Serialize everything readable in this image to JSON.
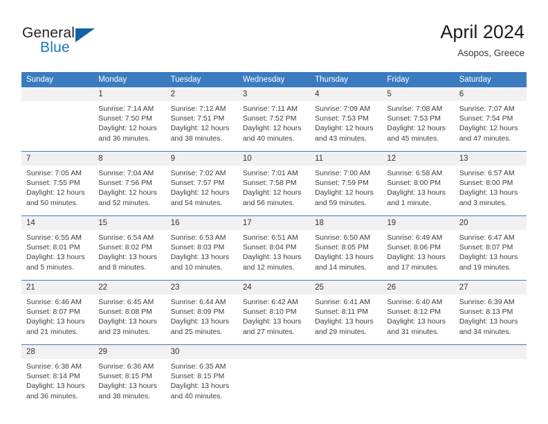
{
  "branding": {
    "logo_primary": "General",
    "logo_secondary": "Blue",
    "accent_color": "#1b76bf",
    "mark_color": "#1461a8"
  },
  "header": {
    "title": "April 2024",
    "location": "Asopos, Greece"
  },
  "calendar": {
    "header_bg": "#3b7cc0",
    "daynum_bg": "#f1f1f1",
    "weekday_headers": [
      "Sunday",
      "Monday",
      "Tuesday",
      "Wednesday",
      "Thursday",
      "Friday",
      "Saturday"
    ],
    "weeks": [
      [
        {
          "day": "",
          "sunrise": "",
          "sunset": "",
          "daylight_1": "",
          "daylight_2": ""
        },
        {
          "day": "1",
          "sunrise": "Sunrise: 7:14 AM",
          "sunset": "Sunset: 7:50 PM",
          "daylight_1": "Daylight: 12 hours",
          "daylight_2": "and 36 minutes."
        },
        {
          "day": "2",
          "sunrise": "Sunrise: 7:12 AM",
          "sunset": "Sunset: 7:51 PM",
          "daylight_1": "Daylight: 12 hours",
          "daylight_2": "and 38 minutes."
        },
        {
          "day": "3",
          "sunrise": "Sunrise: 7:11 AM",
          "sunset": "Sunset: 7:52 PM",
          "daylight_1": "Daylight: 12 hours",
          "daylight_2": "and 40 minutes."
        },
        {
          "day": "4",
          "sunrise": "Sunrise: 7:09 AM",
          "sunset": "Sunset: 7:53 PM",
          "daylight_1": "Daylight: 12 hours",
          "daylight_2": "and 43 minutes."
        },
        {
          "day": "5",
          "sunrise": "Sunrise: 7:08 AM",
          "sunset": "Sunset: 7:53 PM",
          "daylight_1": "Daylight: 12 hours",
          "daylight_2": "and 45 minutes."
        },
        {
          "day": "6",
          "sunrise": "Sunrise: 7:07 AM",
          "sunset": "Sunset: 7:54 PM",
          "daylight_1": "Daylight: 12 hours",
          "daylight_2": "and 47 minutes."
        }
      ],
      [
        {
          "day": "7",
          "sunrise": "Sunrise: 7:05 AM",
          "sunset": "Sunset: 7:55 PM",
          "daylight_1": "Daylight: 12 hours",
          "daylight_2": "and 50 minutes."
        },
        {
          "day": "8",
          "sunrise": "Sunrise: 7:04 AM",
          "sunset": "Sunset: 7:56 PM",
          "daylight_1": "Daylight: 12 hours",
          "daylight_2": "and 52 minutes."
        },
        {
          "day": "9",
          "sunrise": "Sunrise: 7:02 AM",
          "sunset": "Sunset: 7:57 PM",
          "daylight_1": "Daylight: 12 hours",
          "daylight_2": "and 54 minutes."
        },
        {
          "day": "10",
          "sunrise": "Sunrise: 7:01 AM",
          "sunset": "Sunset: 7:58 PM",
          "daylight_1": "Daylight: 12 hours",
          "daylight_2": "and 56 minutes."
        },
        {
          "day": "11",
          "sunrise": "Sunrise: 7:00 AM",
          "sunset": "Sunset: 7:59 PM",
          "daylight_1": "Daylight: 12 hours",
          "daylight_2": "and 59 minutes."
        },
        {
          "day": "12",
          "sunrise": "Sunrise: 6:58 AM",
          "sunset": "Sunset: 8:00 PM",
          "daylight_1": "Daylight: 13 hours",
          "daylight_2": "and 1 minute."
        },
        {
          "day": "13",
          "sunrise": "Sunrise: 6:57 AM",
          "sunset": "Sunset: 8:00 PM",
          "daylight_1": "Daylight: 13 hours",
          "daylight_2": "and 3 minutes."
        }
      ],
      [
        {
          "day": "14",
          "sunrise": "Sunrise: 6:55 AM",
          "sunset": "Sunset: 8:01 PM",
          "daylight_1": "Daylight: 13 hours",
          "daylight_2": "and 5 minutes."
        },
        {
          "day": "15",
          "sunrise": "Sunrise: 6:54 AM",
          "sunset": "Sunset: 8:02 PM",
          "daylight_1": "Daylight: 13 hours",
          "daylight_2": "and 8 minutes."
        },
        {
          "day": "16",
          "sunrise": "Sunrise: 6:53 AM",
          "sunset": "Sunset: 8:03 PM",
          "daylight_1": "Daylight: 13 hours",
          "daylight_2": "and 10 minutes."
        },
        {
          "day": "17",
          "sunrise": "Sunrise: 6:51 AM",
          "sunset": "Sunset: 8:04 PM",
          "daylight_1": "Daylight: 13 hours",
          "daylight_2": "and 12 minutes."
        },
        {
          "day": "18",
          "sunrise": "Sunrise: 6:50 AM",
          "sunset": "Sunset: 8:05 PM",
          "daylight_1": "Daylight: 13 hours",
          "daylight_2": "and 14 minutes."
        },
        {
          "day": "19",
          "sunrise": "Sunrise: 6:49 AM",
          "sunset": "Sunset: 8:06 PM",
          "daylight_1": "Daylight: 13 hours",
          "daylight_2": "and 17 minutes."
        },
        {
          "day": "20",
          "sunrise": "Sunrise: 6:47 AM",
          "sunset": "Sunset: 8:07 PM",
          "daylight_1": "Daylight: 13 hours",
          "daylight_2": "and 19 minutes."
        }
      ],
      [
        {
          "day": "21",
          "sunrise": "Sunrise: 6:46 AM",
          "sunset": "Sunset: 8:07 PM",
          "daylight_1": "Daylight: 13 hours",
          "daylight_2": "and 21 minutes."
        },
        {
          "day": "22",
          "sunrise": "Sunrise: 6:45 AM",
          "sunset": "Sunset: 8:08 PM",
          "daylight_1": "Daylight: 13 hours",
          "daylight_2": "and 23 minutes."
        },
        {
          "day": "23",
          "sunrise": "Sunrise: 6:44 AM",
          "sunset": "Sunset: 8:09 PM",
          "daylight_1": "Daylight: 13 hours",
          "daylight_2": "and 25 minutes."
        },
        {
          "day": "24",
          "sunrise": "Sunrise: 6:42 AM",
          "sunset": "Sunset: 8:10 PM",
          "daylight_1": "Daylight: 13 hours",
          "daylight_2": "and 27 minutes."
        },
        {
          "day": "25",
          "sunrise": "Sunrise: 6:41 AM",
          "sunset": "Sunset: 8:11 PM",
          "daylight_1": "Daylight: 13 hours",
          "daylight_2": "and 29 minutes."
        },
        {
          "day": "26",
          "sunrise": "Sunrise: 6:40 AM",
          "sunset": "Sunset: 8:12 PM",
          "daylight_1": "Daylight: 13 hours",
          "daylight_2": "and 31 minutes."
        },
        {
          "day": "27",
          "sunrise": "Sunrise: 6:39 AM",
          "sunset": "Sunset: 8:13 PM",
          "daylight_1": "Daylight: 13 hours",
          "daylight_2": "and 34 minutes."
        }
      ],
      [
        {
          "day": "28",
          "sunrise": "Sunrise: 6:38 AM",
          "sunset": "Sunset: 8:14 PM",
          "daylight_1": "Daylight: 13 hours",
          "daylight_2": "and 36 minutes."
        },
        {
          "day": "29",
          "sunrise": "Sunrise: 6:36 AM",
          "sunset": "Sunset: 8:15 PM",
          "daylight_1": "Daylight: 13 hours",
          "daylight_2": "and 38 minutes."
        },
        {
          "day": "30",
          "sunrise": "Sunrise: 6:35 AM",
          "sunset": "Sunset: 8:15 PM",
          "daylight_1": "Daylight: 13 hours",
          "daylight_2": "and 40 minutes."
        },
        {
          "day": "",
          "sunrise": "",
          "sunset": "",
          "daylight_1": "",
          "daylight_2": ""
        },
        {
          "day": "",
          "sunrise": "",
          "sunset": "",
          "daylight_1": "",
          "daylight_2": ""
        },
        {
          "day": "",
          "sunrise": "",
          "sunset": "",
          "daylight_1": "",
          "daylight_2": ""
        },
        {
          "day": "",
          "sunrise": "",
          "sunset": "",
          "daylight_1": "",
          "daylight_2": ""
        }
      ]
    ]
  }
}
